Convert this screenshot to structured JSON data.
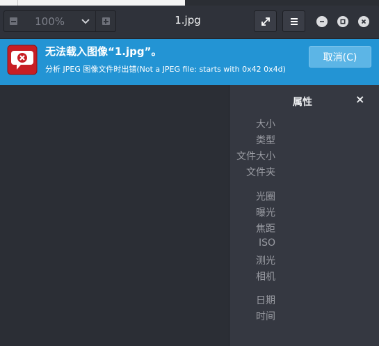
{
  "window": {
    "title": "1.jpg",
    "zoom": {
      "value": "100%"
    }
  },
  "icons": {
    "zoom_out": "minus-square-icon",
    "zoom_in": "plus-square-icon",
    "zoom_menu": "chevron-down-icon",
    "fullscreen": "fullscreen-icon",
    "menu": "hamburger-menu-icon",
    "minimize": "minimize-icon",
    "maximize": "maximize-icon",
    "close": "close-icon",
    "error": "error-icon"
  },
  "infobar": {
    "title": "无法载入图像“1.jpg”。",
    "message": "分析 JPEG 图像文件时出错(Not a JPEG file: starts with 0x42 0x4d)",
    "cancel_label": "取消(C)"
  },
  "sidebar": {
    "title": "属性",
    "close_glyph": "×",
    "properties": [
      {
        "label": "大小"
      },
      {
        "label": "类型"
      },
      {
        "label": "文件大小"
      },
      {
        "label": "文件夹"
      },
      {
        "label": "光圈"
      },
      {
        "label": "曝光"
      },
      {
        "label": "焦距"
      },
      {
        "label": "ISO"
      },
      {
        "label": "测光"
      },
      {
        "label": "相机"
      },
      {
        "label": "日期"
      },
      {
        "label": "时间"
      }
    ]
  },
  "colors": {
    "infobar": "#2394d4",
    "window": "#353841",
    "canvas": "#2b2e35",
    "error_red": "#d7242c"
  }
}
